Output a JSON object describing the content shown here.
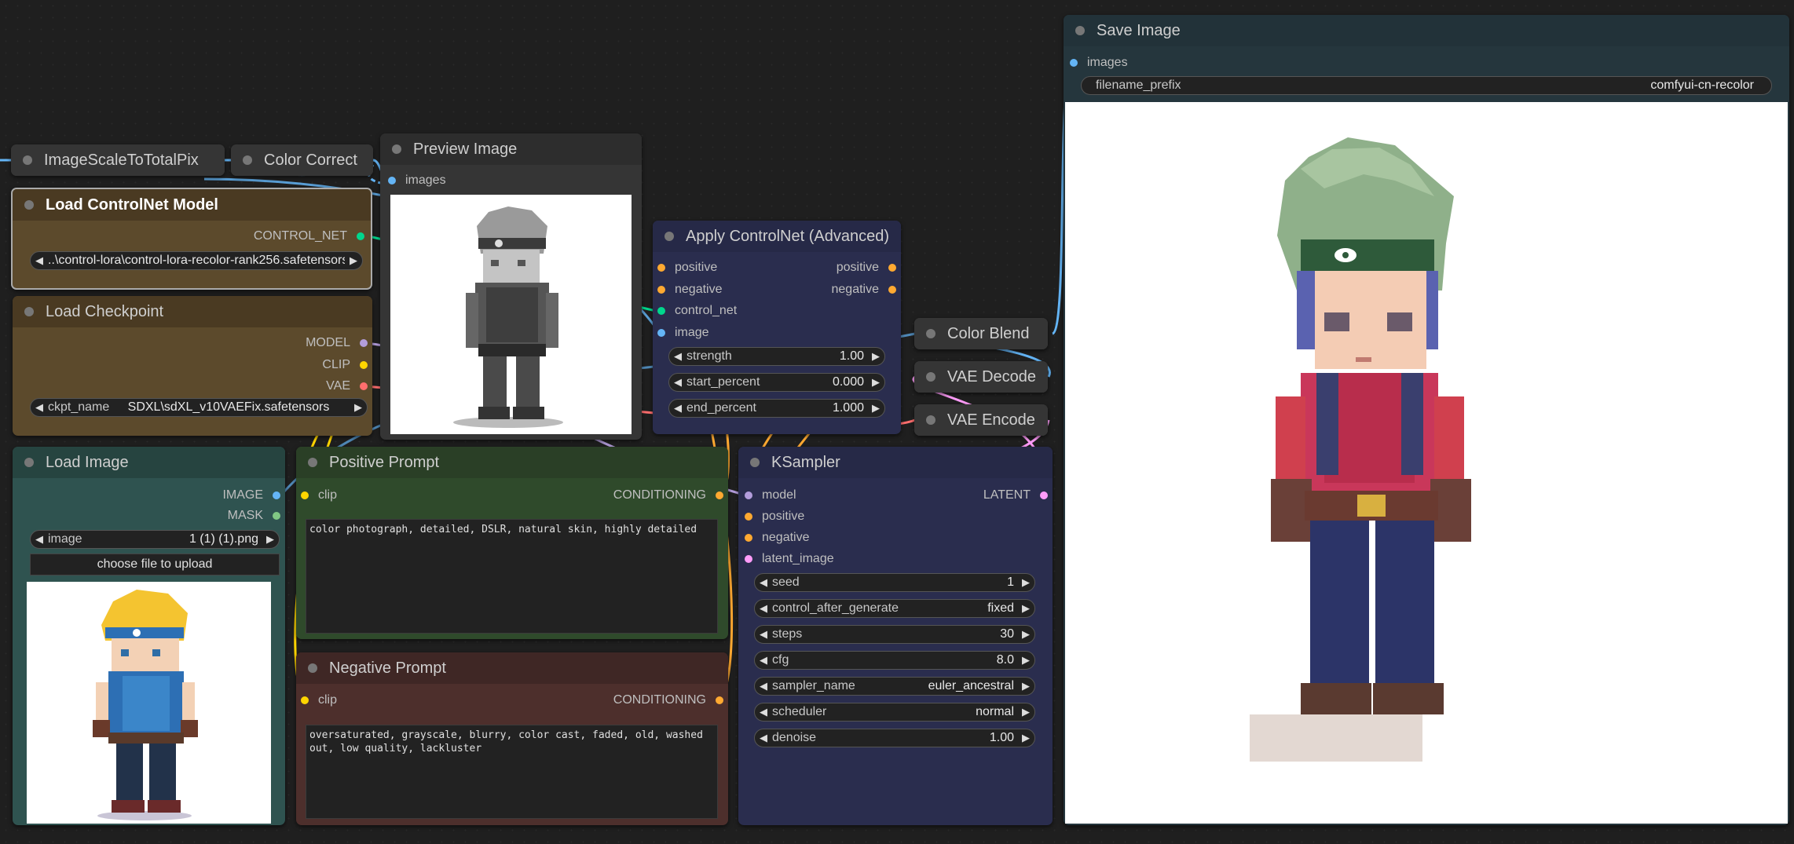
{
  "colors": {
    "model_pin": "#b39ddb",
    "clip_pin": "#ffd500",
    "vae_pin": "#ff6e6e",
    "conditioning_pin": "#ffa931",
    "image_pin": "#64b5f6",
    "mask_pin": "#81c784",
    "control_net_pin": "#00d78d",
    "latent_pin": "#ff9cf9"
  },
  "nodes": {
    "image_scale": {
      "title": "ImageScaleToTotalPix"
    },
    "color_correct": {
      "title": "Color Correct"
    },
    "preview_image": {
      "title": "Preview Image",
      "input_images": "images"
    },
    "load_controlnet": {
      "title": "Load ControlNet Model",
      "output": "CONTROL_NET",
      "widget_value": "..\\control-lora\\control-lora-recolor-rank256.safetensors"
    },
    "load_checkpoint": {
      "title": "Load Checkpoint",
      "outputs": [
        "MODEL",
        "CLIP",
        "VAE"
      ],
      "widget_label": "ckpt_name",
      "widget_value": "SDXL\\sdXL_v10VAEFix.safetensors"
    },
    "load_image": {
      "title": "Load Image",
      "outputs": [
        "IMAGE",
        "MASK"
      ],
      "widget_label": "image",
      "widget_value": "1 (1) (1).png",
      "upload_button": "choose file to upload"
    },
    "positive_prompt": {
      "title": "Positive Prompt",
      "input": "clip",
      "output": "CONDITIONING",
      "text": "color photograph, detailed, DSLR, natural skin, highly detailed"
    },
    "negative_prompt": {
      "title": "Negative Prompt",
      "input": "clip",
      "output": "CONDITIONING",
      "text": "oversaturated, grayscale, blurry, color cast, faded, old, washed out, low quality, lackluster"
    },
    "apply_controlnet": {
      "title": "Apply ControlNet (Advanced)",
      "inputs": [
        "positive",
        "negative",
        "control_net",
        "image"
      ],
      "outputs": [
        "positive",
        "negative"
      ],
      "widgets": [
        {
          "label": "strength",
          "value": "1.00"
        },
        {
          "label": "start_percent",
          "value": "0.000"
        },
        {
          "label": "end_percent",
          "value": "1.000"
        }
      ]
    },
    "color_blend": {
      "title": "Color Blend"
    },
    "vae_decode": {
      "title": "VAE Decode"
    },
    "vae_encode": {
      "title": "VAE Encode"
    },
    "ksampler": {
      "title": "KSampler",
      "inputs": [
        "model",
        "positive",
        "negative",
        "latent_image"
      ],
      "output": "LATENT",
      "widgets": [
        {
          "label": "seed",
          "value": "1"
        },
        {
          "label": "control_after_generate",
          "value": "fixed"
        },
        {
          "label": "steps",
          "value": "30"
        },
        {
          "label": "cfg",
          "value": "8.0"
        },
        {
          "label": "sampler_name",
          "value": "euler_ancestral"
        },
        {
          "label": "scheduler",
          "value": "normal"
        },
        {
          "label": "denoise",
          "value": "1.00"
        }
      ]
    },
    "save_image": {
      "title": "Save Image",
      "input_images": "images",
      "widget_label": "filename_prefix",
      "widget_value": "comfyui-cn-recolor"
    }
  }
}
